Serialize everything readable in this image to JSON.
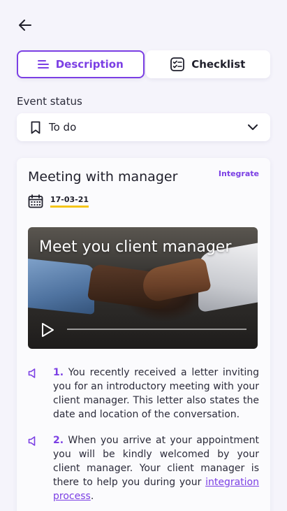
{
  "tabs": [
    {
      "label": "Description",
      "icon": "lines-icon",
      "active": true
    },
    {
      "label": "Checklist",
      "icon": "checklist-icon",
      "active": false
    }
  ],
  "status": {
    "label": "Event status",
    "value": "To do",
    "icon": "bookmark-icon"
  },
  "card": {
    "title": "Meeting with manager",
    "integrate_label": "Integrate",
    "date": "17-03-21",
    "video": {
      "title": "Meet you client manager",
      "progress": 0.0
    },
    "steps": [
      {
        "number": "1.",
        "text": " You recently received a letter inviting you for an introductory meeting with your client manager. This letter also states the date and location of the conversation."
      },
      {
        "number": "2.",
        "text_before": " When you arrive at your appointment you will be kindly welcomed by your client manager. Your client manager is there to help you during your ",
        "link": "integration process",
        "text_after": "."
      }
    ]
  },
  "colors": {
    "accent": "#7b3fe4",
    "date_underline": "#f5c518",
    "background": "#f5f4fb"
  }
}
